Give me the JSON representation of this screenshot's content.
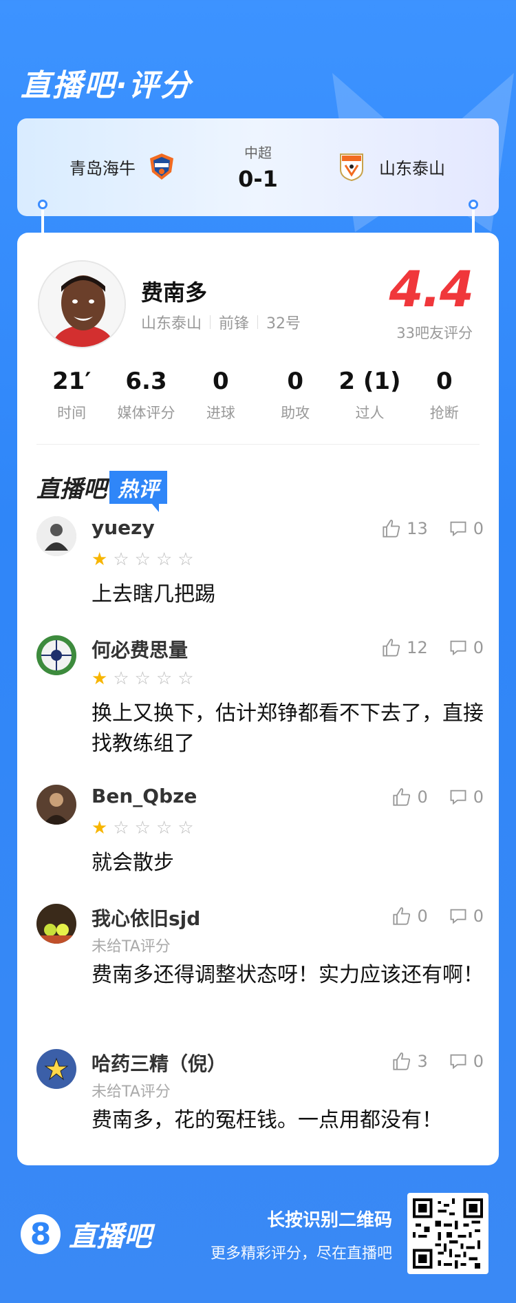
{
  "header": {
    "brand_title": "直播吧·评分"
  },
  "match": {
    "home_team": "青岛海牛",
    "away_team": "山东泰山",
    "league": "中超",
    "score": "0-1"
  },
  "player": {
    "name": "费南多",
    "team": "山东泰山",
    "position": "前锋",
    "number": "32号",
    "rating": "4.4",
    "rating_label": "33吧友评分"
  },
  "stats": [
    {
      "value": "21′",
      "label": "时间"
    },
    {
      "value": "6.3",
      "label": "媒体评分"
    },
    {
      "value": "0",
      "label": "进球"
    },
    {
      "value": "0",
      "label": "助攻"
    },
    {
      "value": "2 (1)",
      "label": "过人"
    },
    {
      "value": "0",
      "label": "抢断"
    }
  ],
  "hot_section": {
    "title_part1": "直播吧",
    "title_part2": "热评"
  },
  "comments": [
    {
      "user": "yuezy",
      "likes": "13",
      "dislikes": "0",
      "stars": 1,
      "rated": true,
      "text": "上去瞎几把踢"
    },
    {
      "user": "何必费思量",
      "likes": "12",
      "dislikes": "0",
      "stars": 1,
      "rated": true,
      "text": "换上又换下，估计郑铮都看不下去了，直接找教练组了"
    },
    {
      "user": "Ben_Qbze",
      "likes": "0",
      "dislikes": "0",
      "stars": 1,
      "rated": true,
      "text": "就会散步"
    },
    {
      "user": "我心依旧sjd",
      "likes": "0",
      "dislikes": "0",
      "stars": 0,
      "rated": false,
      "unrated_label": "未给TA评分",
      "text": "费南多还得调整状态呀！实力应该还有啊！"
    },
    {
      "user": "哈药三精（倪）",
      "likes": "3",
      "dislikes": "0",
      "stars": 0,
      "rated": false,
      "unrated_label": "未给TA评分",
      "text": "费南多，花的冤枉钱。一点用都没有！"
    }
  ],
  "footer": {
    "logo_glyph": "8",
    "logo_text": "直播吧",
    "cta_primary": "长按识别二维码",
    "cta_secondary": "更多精彩评分，尽在直播吧"
  },
  "colors": {
    "accent": "#2f86f8",
    "rating": "#f0373b",
    "star": "#f7b500"
  }
}
